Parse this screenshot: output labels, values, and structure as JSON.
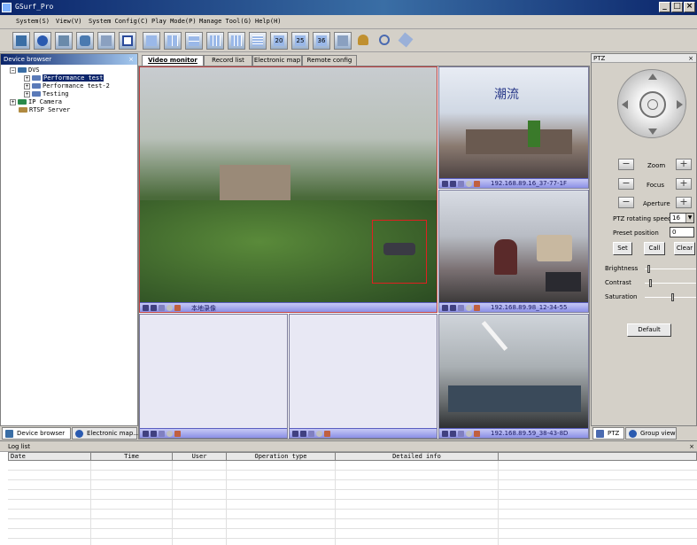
{
  "window": {
    "title": "GSurf_Pro",
    "min_glyph": "_",
    "max_glyph": "□",
    "close_glyph": "×"
  },
  "menu": [
    "System(S)",
    "View(V)",
    "System Config(C)",
    "Play Mode(P)",
    "Manage Tool(G)",
    "Help(H)"
  ],
  "toolbar": {
    "layout_labels": {
      "l20": "20",
      "l25": "25",
      "l36": "36"
    }
  },
  "device_browser": {
    "title": "Device browser",
    "close_glyph": "×",
    "root": "DVS",
    "items": [
      "Performance test",
      "Performance test-2",
      "Testing"
    ],
    "ip_camera": "IP Camera",
    "rtsp": "RTSP Server",
    "expand_plus": "+",
    "expand_minus": "−"
  },
  "left_tabs": [
    "Device browser",
    "Electronic map..."
  ],
  "video_tabs": [
    "Video monitor",
    "Record list",
    "Electronic map",
    "Remote config"
  ],
  "cells": {
    "main_label": "本地录像",
    "cam1_label": "192.168.89.16_37-77-1F",
    "cam2_label": "192.168.89.98_12-34-55",
    "cam3_label": "192.168.89.59_38-43-8D",
    "cam1_sign": "潮流"
  },
  "ptz": {
    "title": "PTZ",
    "close_glyph": "×",
    "zoom": "Zoom",
    "focus": "Focus",
    "aperture": "Aperture",
    "minus": "−",
    "plus": "+",
    "rotating_speed_label": "PTZ rotating speed",
    "rotating_speed_value": "16",
    "preset_label": "Preset position",
    "preset_value": "0",
    "set": "Set",
    "call": "Call",
    "clear": "Clear",
    "brightness": "Brightness",
    "contrast": "Contrast",
    "saturation": "Saturation",
    "default": "Default",
    "brightness_level": 0.05,
    "contrast_level": 0.1,
    "saturation_level": 0.55
  },
  "right_tabs": [
    "PTZ",
    "Group view"
  ],
  "log": {
    "title": "Log list",
    "close_glyph": "×",
    "columns": [
      "Date",
      "Time",
      "User",
      "Operation type",
      "Detailed info"
    ]
  }
}
